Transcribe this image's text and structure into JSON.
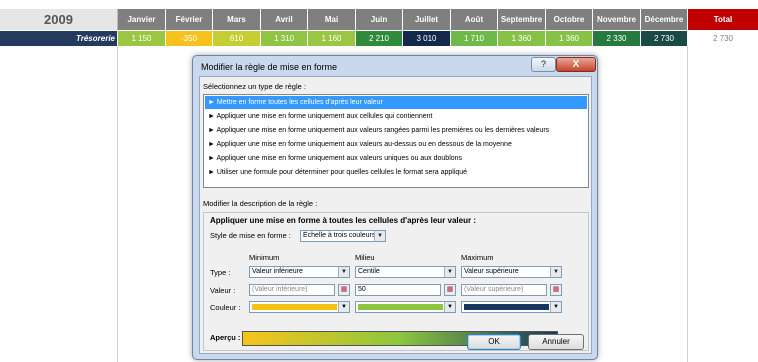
{
  "sheet": {
    "year": "2009",
    "row_label": "Trésorerie",
    "months": [
      {
        "name": "Janvier",
        "value": "1 150",
        "header_color": "#7f7f7f",
        "cell_bg": "#9bc644",
        "cell_fg": "#ffffff"
      },
      {
        "name": "Février",
        "value": "-350",
        "header_color": "#7f7f7f",
        "cell_bg": "#f6c21d",
        "cell_fg": "#ffffff"
      },
      {
        "name": "Mars",
        "value": "610",
        "header_color": "#7f7f7f",
        "cell_bg": "#c5cf33",
        "cell_fg": "#ffffff"
      },
      {
        "name": "Avril",
        "value": "1 310",
        "header_color": "#7f7f7f",
        "cell_bg": "#8fc445",
        "cell_fg": "#ffffff"
      },
      {
        "name": "Mai",
        "value": "1 160",
        "header_color": "#7f7f7f",
        "cell_bg": "#9bc644",
        "cell_fg": "#ffffff"
      },
      {
        "name": "Juin",
        "value": "2 210",
        "header_color": "#7f7f7f",
        "cell_bg": "#2f8a3c",
        "cell_fg": "#ffffff"
      },
      {
        "name": "Juillet",
        "value": "3 010",
        "header_color": "#7f7f7f",
        "cell_bg": "#13284a",
        "cell_fg": "#ffffff"
      },
      {
        "name": "Août",
        "value": "1 710",
        "header_color": "#7f7f7f",
        "cell_bg": "#6fb94a",
        "cell_fg": "#ffffff"
      },
      {
        "name": "Septembre",
        "value": "1 360",
        "header_color": "#7f7f7f",
        "cell_bg": "#86c246",
        "cell_fg": "#ffffff"
      },
      {
        "name": "Octobre",
        "value": "1 360",
        "header_color": "#7f7f7f",
        "cell_bg": "#86c246",
        "cell_fg": "#ffffff"
      },
      {
        "name": "Novembre",
        "value": "2 330",
        "header_color": "#7f7f7f",
        "cell_bg": "#267a3f",
        "cell_fg": "#ffffff"
      },
      {
        "name": "Décembre",
        "value": "2 730",
        "header_color": "#7f7f7f",
        "cell_bg": "#1a4a46",
        "cell_fg": "#ffffff"
      }
    ],
    "total": {
      "name": "Total",
      "value": "2 730",
      "header_color": "#c00000",
      "cell_fg": "#808080"
    }
  },
  "dialog": {
    "title": "Modifier la règle de mise en forme",
    "help_label": "?",
    "close_label": "X",
    "select_rule_label": "Sélectionnez un type de règle :",
    "rule_types": [
      "► Mettre en forme toutes les cellules d'après leur valeur",
      "► Appliquer une mise en forme uniquement aux cellules qui contiennent",
      "► Appliquer une mise en forme uniquement aux valeurs rangées parmi les premières ou les dernières valeurs",
      "► Appliquer une mise en forme uniquement aux valeurs au-dessus ou en dessous de la moyenne",
      "► Appliquer une mise en forme uniquement aux valeurs uniques ou aux doublons",
      "► Utiliser une formule pour déterminer pour quelles cellules le format sera appliqué"
    ],
    "selected_rule_index": 0,
    "edit_desc_label": "Modifier la description de la règle :",
    "desc_title": "Appliquer une mise en forme à toutes les cellules d'après leur valeur :",
    "format_style_label": "Style de mise en forme :",
    "format_style_value": "Échelle à trois couleurs",
    "columns": {
      "min": "Minimum",
      "mid": "Milieu",
      "max": "Maximum"
    },
    "row_labels": {
      "type": "Type :",
      "value": "Valeur :",
      "color": "Couleur :"
    },
    "min": {
      "type": "Valeur inférieure",
      "value": "(Valeur inférieure)",
      "color": "#f5c211"
    },
    "mid": {
      "type": "Centile",
      "value": "50",
      "color": "#8cc63f"
    },
    "max": {
      "type": "Valeur supérieure",
      "value": "(Valeur supérieure)",
      "color": "#17375e"
    },
    "preview_label": "Aperçu :",
    "ok_label": "OK",
    "cancel_label": "Annuler"
  }
}
